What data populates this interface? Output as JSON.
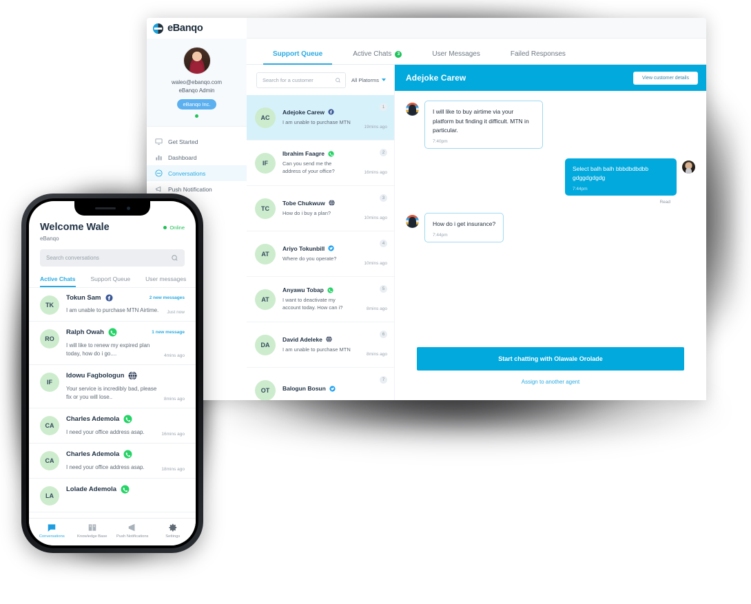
{
  "desktop": {
    "brand": {
      "name": "eBanqo",
      "logo_icon": "ebanqo-logo-icon"
    },
    "profile": {
      "avatar_icon": "user-avatar",
      "email": "waleo@ebanqo.com",
      "role": "eBanqo Admin",
      "company_badge": "eBanqo Inc.",
      "status_color": "#21c45b"
    },
    "nav": [
      {
        "label": "Get Started",
        "icon": "monitor-icon",
        "active": false
      },
      {
        "label": "Dashboard",
        "icon": "bar-chart-icon",
        "active": false
      },
      {
        "label": "Conversations",
        "icon": "chat-circle-icon",
        "active": true
      },
      {
        "label": "Push Notification",
        "icon": "megaphone-icon",
        "active": false
      },
      {
        "label": "ons",
        "icon": "partial-icon",
        "active": false
      }
    ],
    "tabs": [
      {
        "label": "Support Queue",
        "badge": "",
        "active": true
      },
      {
        "label": "Active Chats",
        "badge": "3",
        "active": false
      },
      {
        "label": "User Messages",
        "badge": "",
        "active": false
      },
      {
        "label": "Failed Responses",
        "badge": "",
        "active": false
      }
    ],
    "search": {
      "placeholder": "Search for a customer",
      "value": "",
      "icon": "search-icon"
    },
    "platform_filter": {
      "label": "All Platorms",
      "icon": "chevron-down-icon"
    },
    "conversations": [
      {
        "initials": "AC",
        "name": "Adejoke Carew",
        "channel": "facebook",
        "message": "I am unable to purchase MTN",
        "number": "1",
        "time": "19mins ago",
        "selected": true
      },
      {
        "initials": "IF",
        "name": "Ibrahim Faagre",
        "channel": "whatsapp",
        "message": "Can you send me the address of your office?",
        "number": "2",
        "time": "16mins ago",
        "selected": false
      },
      {
        "initials": "TC",
        "name": "Tobe Chukwuw",
        "channel": "web",
        "message": "How do i buy a plan?",
        "number": "3",
        "time": "10mins ago",
        "selected": false
      },
      {
        "initials": "AT",
        "name": "Ariyo Tokunbill",
        "channel": "twitter",
        "message": "Where do you operate?",
        "number": "4",
        "time": "10mins ago",
        "selected": false
      },
      {
        "initials": "AT",
        "name": "Anyawu Tobap",
        "channel": "whatsapp",
        "message": "I want to deactivate my account today. How can i?",
        "number": "5",
        "time": "8mins ago",
        "selected": false
      },
      {
        "initials": "DA",
        "name": "David Adeleke",
        "channel": "web",
        "message": "I am unable to purchase MTN",
        "number": "6",
        "time": "8mins ago",
        "selected": false
      },
      {
        "initials": "OT",
        "name": "Balogun Bosun",
        "channel": "twitter",
        "message": "",
        "number": "7",
        "time": "",
        "selected": false
      }
    ],
    "chat": {
      "title": "Adejoke Carew",
      "details_button": "View customer details",
      "messages": [
        {
          "side": "in",
          "text": "I will like to buy airtime via your platform but finding it difficult. MTN in particular.",
          "time": "7:40pm",
          "avatar_icon": "customer-avatar"
        },
        {
          "side": "out",
          "text": "Select balh balh bbbdbdbdbb gdggdgdgdg",
          "time": "7:44pm",
          "avatar_icon": "agent-avatar",
          "receipt": "Read"
        },
        {
          "side": "in",
          "text": "How do i get insurance?",
          "time": "7:44pm",
          "avatar_icon": "customer-avatar"
        }
      ],
      "start_button": "Start chatting with Olawale Orolade",
      "assign_link": "Assign to another agent"
    }
  },
  "mobile": {
    "greeting": "Welcome Wale",
    "brand": "eBanqo",
    "status": {
      "label": "Online",
      "color": "#20bf55"
    },
    "search": {
      "placeholder": "Search conversations",
      "value": "",
      "icon": "search-icon"
    },
    "tabs": [
      {
        "label": "Active Chats",
        "active": true
      },
      {
        "label": "Support Queue",
        "active": false
      },
      {
        "label": "User messages",
        "active": false
      }
    ],
    "conversations": [
      {
        "initials": "TK",
        "name": "Tokun Sam",
        "channel": "facebook",
        "badge": "2 new messages",
        "message": "I am unable to purchase MTN Airtime.",
        "time": "Just now"
      },
      {
        "initials": "RO",
        "name": "Ralph Owah",
        "channel": "whatsapp",
        "badge": "1 new message",
        "message": "I will like to renew my expired plan today, how do i go....",
        "time": "4mins ago"
      },
      {
        "initials": "IF",
        "name": "Idowu Fagbologun",
        "channel": "web",
        "badge": "",
        "message": "Your service is incredibly bad, please fix or you will lose..",
        "time": "8mins ago"
      },
      {
        "initials": "CA",
        "name": "Charles Ademola",
        "channel": "whatsapp",
        "badge": "",
        "message": "I need your office address asap.",
        "time": "16mins ago"
      },
      {
        "initials": "CA",
        "name": "Charles Ademola",
        "channel": "whatsapp",
        "badge": "",
        "message": "I need your office address asap.",
        "time": "18mins ago"
      },
      {
        "initials": "LA",
        "name": "Lolade Ademola",
        "channel": "whatsapp",
        "badge": "",
        "message": "",
        "time": ""
      }
    ],
    "bottom_nav": [
      {
        "label": "Conversations",
        "icon": "chat-icon",
        "active": true
      },
      {
        "label": "Knowledge Base",
        "icon": "book-icon",
        "active": false
      },
      {
        "label": "Push Notifications",
        "icon": "megaphone-icon",
        "active": false
      },
      {
        "label": "Settings",
        "icon": "gear-icon",
        "active": false
      }
    ]
  },
  "colors": {
    "accent": "#02a9dd",
    "brand_blue": "#2aaae1",
    "green": "#20bf55",
    "selected_row": "#d7f1fb"
  }
}
